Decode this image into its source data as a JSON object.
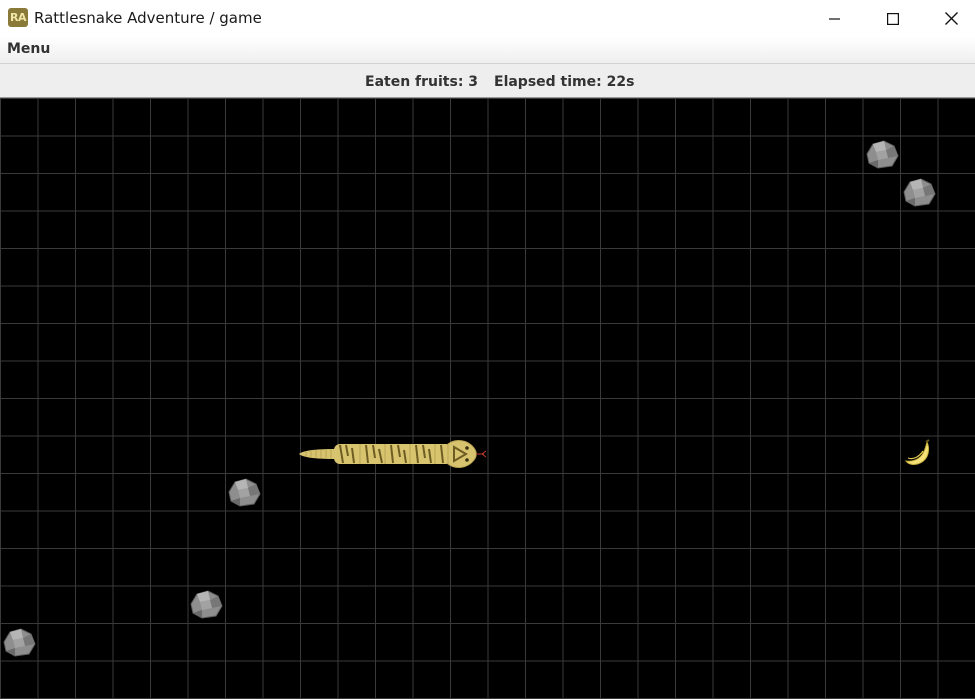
{
  "window": {
    "icon_text": "RA",
    "title": "Rattlesnake Adventure / game",
    "controls": {
      "minimize": "minimize-icon",
      "maximize": "maximize-icon",
      "close": "close-icon"
    }
  },
  "menubar": {
    "menu_label": "Menu"
  },
  "status": {
    "fruits_label": "Eaten fruits: 3",
    "time_label": "Elapsed time: 22s"
  },
  "game": {
    "board_color": "#000000",
    "grid_color": "#3a3a3a",
    "snake_color": "#d8c46f",
    "snake_stripe_color": "#6e5d22",
    "fruit": "banana",
    "fruit_color": "#f7e27a",
    "rock_color": "#8c8c8c",
    "rocks_count": 5
  }
}
